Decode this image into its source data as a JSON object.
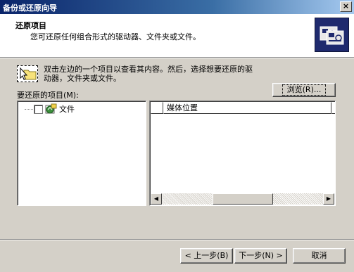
{
  "window": {
    "title": "备份或还原向导",
    "close_glyph": "×"
  },
  "header": {
    "title": "还原项目",
    "subtitle": "您可还原任何组合形式的驱动器、文件夹或文件。"
  },
  "hint": {
    "line1": "双击左边的一个项目以查看其内容。然后，选择想要还原的驱",
    "line2": "动器，文件夹或文件。"
  },
  "browse_button": {
    "label": "浏览(R)..."
  },
  "items_label": "要还原的项目(M):",
  "tree": {
    "items": [
      {
        "label": "文件",
        "checked": false,
        "icon": "file-backup-icon"
      }
    ]
  },
  "list": {
    "columns": [
      "媒体位置"
    ]
  },
  "scrollbar": {
    "left_glyph": "◀",
    "right_glyph": "▶"
  },
  "footer": {
    "back_label": "< 上一步(B)",
    "next_label": "下一步(N) >",
    "cancel_label": "取消"
  }
}
